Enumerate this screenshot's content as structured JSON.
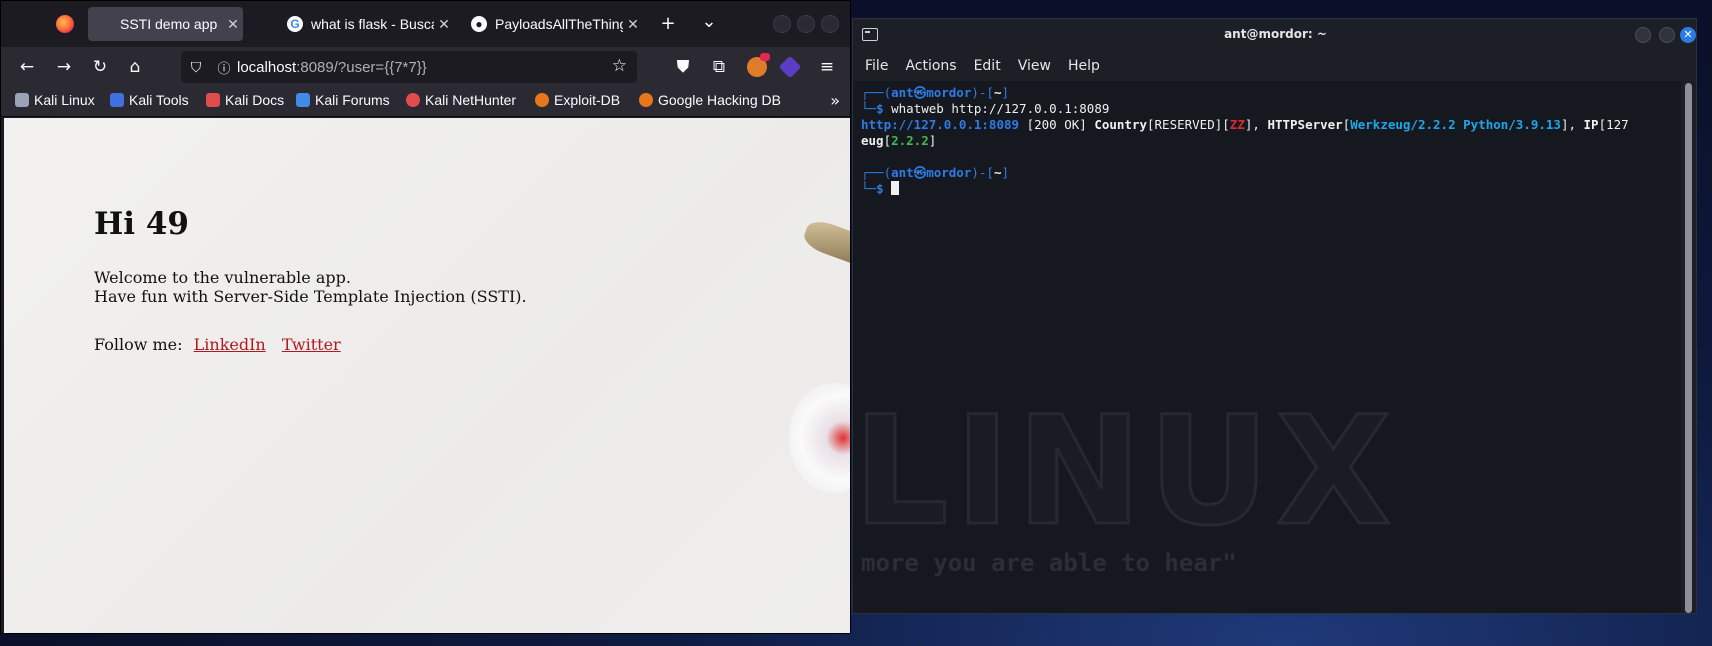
{
  "browser": {
    "tabs": [
      {
        "title": "SSTI demo app",
        "favicon": "page-icon",
        "active": true
      },
      {
        "title": "what is flask - Busca",
        "favicon": "google-icon",
        "active": false
      },
      {
        "title": "PayloadsAllTheThings",
        "favicon": "github-icon",
        "active": false
      }
    ],
    "new_tab": "+",
    "tab_list": "⌄",
    "url": {
      "host": "localhost",
      "path": ":8089/?user={{7*7}}"
    },
    "bookmarks": [
      {
        "label": "Kali Linux",
        "color": "#9aa3b5"
      },
      {
        "label": "Kali Tools",
        "color": "#e04c4c"
      },
      {
        "label": "Kali Docs",
        "color": "#e04c4c"
      },
      {
        "label": "Kali Forums",
        "color": "#3f8be6"
      },
      {
        "label": "Kali NetHunter",
        "color": "#e04c4c"
      },
      {
        "label": "Exploit-DB",
        "color": "#e8771c"
      },
      {
        "label": "Google Hacking DB",
        "color": "#e8771c"
      }
    ],
    "page": {
      "heading": "Hi 49",
      "line1": "Welcome to the vulnerable app.",
      "line2": "Have fun with Server-Side Template Injection (SSTI).",
      "follow_prefix": "Follow me:",
      "links": [
        "LinkedIn",
        "Twitter"
      ],
      "link_color": "#b0191f"
    }
  },
  "terminal": {
    "title": "ant@mordor: ~",
    "menu": [
      "File",
      "Actions",
      "Edit",
      "View",
      "Help"
    ],
    "prompt": {
      "frame_open": "┌──(",
      "user": "ant",
      "at": "㉿",
      "host": "mordor",
      "frame_mid": ")-[",
      "cwd": "~",
      "frame_close": "]",
      "frame_bottom": "└─",
      "dollar": "$"
    },
    "command": "whatweb http://127.0.0.1:8089",
    "output": {
      "url": "http://127.0.0.1:8089",
      "status": " [200 OK] ",
      "country_key": "Country",
      "country_val": "[RESERVED][",
      "country_code": "ZZ",
      "country_close": "], ",
      "server_key": "HTTPServer",
      "server_open": "[",
      "server_val": "Werkzeug/2.2.2 Python/3.9.13",
      "server_close": "], ",
      "ip_key": "IP",
      "ip_val": "[127",
      "wrap_key": "eug",
      "wrap_open": "[",
      "wrap_val": "2.2.2",
      "wrap_close": "]"
    },
    "watermark": "LINUX",
    "quote": "more you are able to hear\""
  }
}
